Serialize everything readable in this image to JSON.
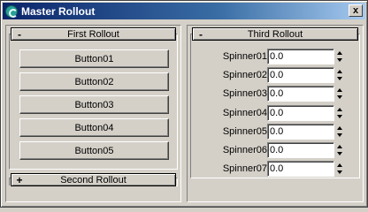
{
  "window": {
    "title": "Master Rollout",
    "icon": "app-logo-icon",
    "close_label": "x"
  },
  "left": {
    "first_rollout": {
      "sign": "-",
      "title": "First Rollout",
      "buttons": [
        "Button01",
        "Button02",
        "Button03",
        "Button04",
        "Button05"
      ]
    },
    "second_rollout": {
      "sign": "+",
      "title": "Second Rollout"
    }
  },
  "right": {
    "third_rollout": {
      "sign": "-",
      "title": "Third Rollout",
      "spinners": [
        {
          "label": "Spinner01",
          "value": "0.0"
        },
        {
          "label": "Spinner02",
          "value": "0.0"
        },
        {
          "label": "Spinner03",
          "value": "0.0"
        },
        {
          "label": "Spinner04",
          "value": "0.0"
        },
        {
          "label": "Spinner05",
          "value": "0.0"
        },
        {
          "label": "Spinner06",
          "value": "0.0"
        },
        {
          "label": "Spinner07",
          "value": "0.0"
        }
      ]
    }
  }
}
